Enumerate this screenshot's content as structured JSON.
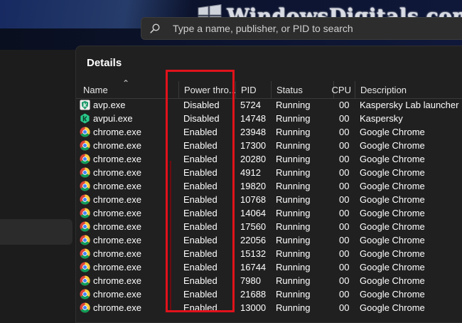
{
  "watermark": {
    "text": "WindowsDigitals.com"
  },
  "search": {
    "placeholder": "Type a name, publisher, or PID to search"
  },
  "panel": {
    "title": "Details"
  },
  "columns": {
    "name": "Name",
    "power": "Power thro...",
    "pid": "PID",
    "status": "Status",
    "cpu": "CPU",
    "desc": "Description"
  },
  "colors": {
    "highlight": "#e0121b",
    "background": "#1c1c1c",
    "panel": "#202020"
  },
  "rows": [
    {
      "icon": "kaspersky-shield-icon",
      "name": "avp.exe",
      "power": "Disabled",
      "pid": "5724",
      "status": "Running",
      "cpu": "00",
      "desc": "Kaspersky Lab launcher"
    },
    {
      "icon": "kaspersky-k-icon",
      "name": "avpui.exe",
      "power": "Disabled",
      "pid": "14748",
      "status": "Running",
      "cpu": "00",
      "desc": "Kaspersky"
    },
    {
      "icon": "chrome-icon",
      "name": "chrome.exe",
      "power": "Enabled",
      "pid": "23948",
      "status": "Running",
      "cpu": "00",
      "desc": "Google Chrome"
    },
    {
      "icon": "chrome-icon",
      "name": "chrome.exe",
      "power": "Enabled",
      "pid": "17300",
      "status": "Running",
      "cpu": "00",
      "desc": "Google Chrome"
    },
    {
      "icon": "chrome-icon",
      "name": "chrome.exe",
      "power": "Enabled",
      "pid": "20280",
      "status": "Running",
      "cpu": "00",
      "desc": "Google Chrome"
    },
    {
      "icon": "chrome-icon",
      "name": "chrome.exe",
      "power": "Enabled",
      "pid": "4912",
      "status": "Running",
      "cpu": "00",
      "desc": "Google Chrome"
    },
    {
      "icon": "chrome-icon",
      "name": "chrome.exe",
      "power": "Enabled",
      "pid": "19820",
      "status": "Running",
      "cpu": "00",
      "desc": "Google Chrome"
    },
    {
      "icon": "chrome-icon",
      "name": "chrome.exe",
      "power": "Enabled",
      "pid": "10768",
      "status": "Running",
      "cpu": "00",
      "desc": "Google Chrome"
    },
    {
      "icon": "chrome-icon",
      "name": "chrome.exe",
      "power": "Enabled",
      "pid": "14064",
      "status": "Running",
      "cpu": "00",
      "desc": "Google Chrome"
    },
    {
      "icon": "chrome-icon",
      "name": "chrome.exe",
      "power": "Enabled",
      "pid": "17560",
      "status": "Running",
      "cpu": "00",
      "desc": "Google Chrome"
    },
    {
      "icon": "chrome-icon",
      "name": "chrome.exe",
      "power": "Enabled",
      "pid": "22056",
      "status": "Running",
      "cpu": "00",
      "desc": "Google Chrome"
    },
    {
      "icon": "chrome-icon",
      "name": "chrome.exe",
      "power": "Enabled",
      "pid": "15132",
      "status": "Running",
      "cpu": "00",
      "desc": "Google Chrome"
    },
    {
      "icon": "chrome-icon",
      "name": "chrome.exe",
      "power": "Enabled",
      "pid": "16744",
      "status": "Running",
      "cpu": "00",
      "desc": "Google Chrome"
    },
    {
      "icon": "chrome-icon",
      "name": "chrome.exe",
      "power": "Enabled",
      "pid": "7980",
      "status": "Running",
      "cpu": "00",
      "desc": "Google Chrome"
    },
    {
      "icon": "chrome-icon",
      "name": "chrome.exe",
      "power": "Enabled",
      "pid": "21688",
      "status": "Running",
      "cpu": "00",
      "desc": "Google Chrome"
    },
    {
      "icon": "chrome-icon",
      "name": "chrome.exe",
      "power": "Enabled",
      "pid": "13000",
      "status": "Running",
      "cpu": "00",
      "desc": "Google Chrome"
    }
  ]
}
